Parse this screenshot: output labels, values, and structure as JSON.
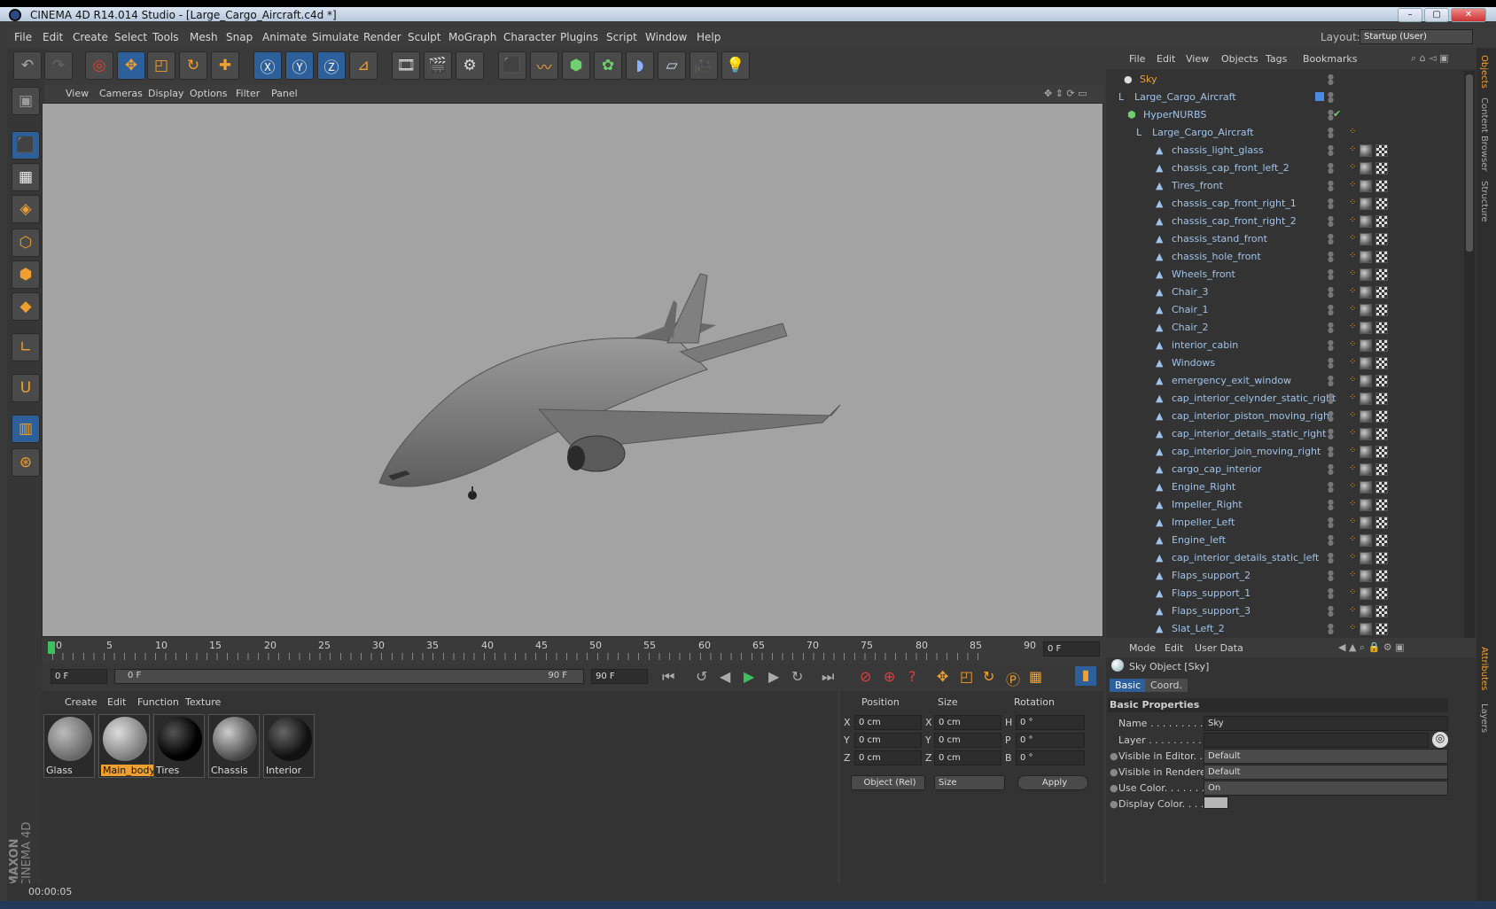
{
  "window": {
    "title": "CINEMA 4D R14.014 Studio - [Large_Cargo_Aircraft.c4d *]",
    "layout_label": "Layout:",
    "layout_value": "Startup (User)"
  },
  "menu": [
    "File",
    "Edit",
    "Create",
    "Select",
    "Tools",
    "Mesh",
    "Snap",
    "Animate",
    "Simulate",
    "Render",
    "Sculpt",
    "MoGraph",
    "Character",
    "Plugins",
    "Script",
    "Window",
    "Help"
  ],
  "viewport_menu": [
    "View",
    "Cameras",
    "Display",
    "Options",
    "Filter",
    "Panel"
  ],
  "timeline": {
    "ticks": [
      "0",
      "5",
      "10",
      "15",
      "20",
      "25",
      "30",
      "35",
      "40",
      "45",
      "50",
      "55",
      "60",
      "65",
      "70",
      "75",
      "80",
      "85",
      "90"
    ],
    "current_frame": "0 F",
    "start": "0 F",
    "range_left": "0 F",
    "range_right": "90 F",
    "end": "90 F"
  },
  "material_menu": [
    "Create",
    "Edit",
    "Function",
    "Texture"
  ],
  "materials": [
    {
      "name": "Glass",
      "selected": false
    },
    {
      "name": "Main_body",
      "selected": true
    },
    {
      "name": "Tires",
      "selected": false
    },
    {
      "name": "Chassis",
      "selected": false
    },
    {
      "name": "Interior",
      "selected": false
    }
  ],
  "coords": {
    "headers": [
      "Position",
      "Size",
      "Rotation"
    ],
    "rows": [
      {
        "a": "X",
        "pos": "0 cm",
        "b": "X",
        "size": "0 cm",
        "c": "H",
        "rot": "0 °"
      },
      {
        "a": "Y",
        "pos": "0 cm",
        "b": "Y",
        "size": "0 cm",
        "c": "P",
        "rot": "0 °"
      },
      {
        "a": "Z",
        "pos": "0 cm",
        "b": "Z",
        "size": "0 cm",
        "c": "B",
        "rot": "0 °"
      }
    ],
    "mode": "Object (Rel)",
    "size_mode": "Size",
    "apply": "Apply"
  },
  "status": {
    "time": "00:00:05"
  },
  "objects_menu": [
    "File",
    "Edit",
    "View",
    "Objects",
    "Tags",
    "Bookmarks"
  ],
  "objects": [
    {
      "name": "Sky",
      "color": "#f0a030"
    },
    {
      "name": "Large_Cargo_Aircraft",
      "color": "#9fc3ea"
    },
    {
      "name": "HyperNURBS",
      "color": "#9fc3ea"
    },
    {
      "name": "Large_Cargo_Aircraft",
      "color": "#9fc3ea"
    },
    {
      "name": "chassis_light_glass"
    },
    {
      "name": "chassis_cap_front_left_2"
    },
    {
      "name": "Tires_front"
    },
    {
      "name": "chassis_cap_front_right_1"
    },
    {
      "name": "chassis_cap_front_right_2"
    },
    {
      "name": "chassis_stand_front"
    },
    {
      "name": "chassis_hole_front"
    },
    {
      "name": "Wheels_front"
    },
    {
      "name": "Chair_3"
    },
    {
      "name": "Chair_1"
    },
    {
      "name": "Chair_2"
    },
    {
      "name": "interior_cabin"
    },
    {
      "name": "Windows"
    },
    {
      "name": "emergency_exit_window"
    },
    {
      "name": "cap_interior_celynder_static_right"
    },
    {
      "name": "cap_interior_piston_moving_right"
    },
    {
      "name": "cap_interior_details_static_right"
    },
    {
      "name": "cap_interior_join_moving_right"
    },
    {
      "name": "cargo_cap_interior"
    },
    {
      "name": "Engine_Right"
    },
    {
      "name": "Impeller_Right"
    },
    {
      "name": "Impeller_Left"
    },
    {
      "name": "Engine_left"
    },
    {
      "name": "cap_interior_details_static_left"
    },
    {
      "name": "Flaps_support_2"
    },
    {
      "name": "Flaps_support_1"
    },
    {
      "name": "Flaps_support_3"
    },
    {
      "name": "Slat_Left_2"
    }
  ],
  "attributes": {
    "menu": [
      "Mode",
      "Edit",
      "User Data"
    ],
    "object_title": "Sky Object [Sky]",
    "tabs": [
      "Basic",
      "Coord."
    ],
    "section": "Basic Properties",
    "props": [
      {
        "label": "Name . . . . . . . . . . .",
        "value": "Sky"
      },
      {
        "label": "Layer . . . . . . . . . . .",
        "value": ""
      },
      {
        "label": "Visible in Editor. . .",
        "value": "Default"
      },
      {
        "label": "Visible in Renderer",
        "value": "Default"
      },
      {
        "label": "Use Color. . . . . . . .",
        "value": "On"
      },
      {
        "label": "Display Color. . . .",
        "value": ""
      }
    ]
  },
  "side_tabs": [
    "Objects",
    "Content Browser",
    "Structure",
    "Attributes",
    "Layers"
  ],
  "logo": {
    "line1": "MAXON",
    "line2": "CINEMA 4D"
  }
}
